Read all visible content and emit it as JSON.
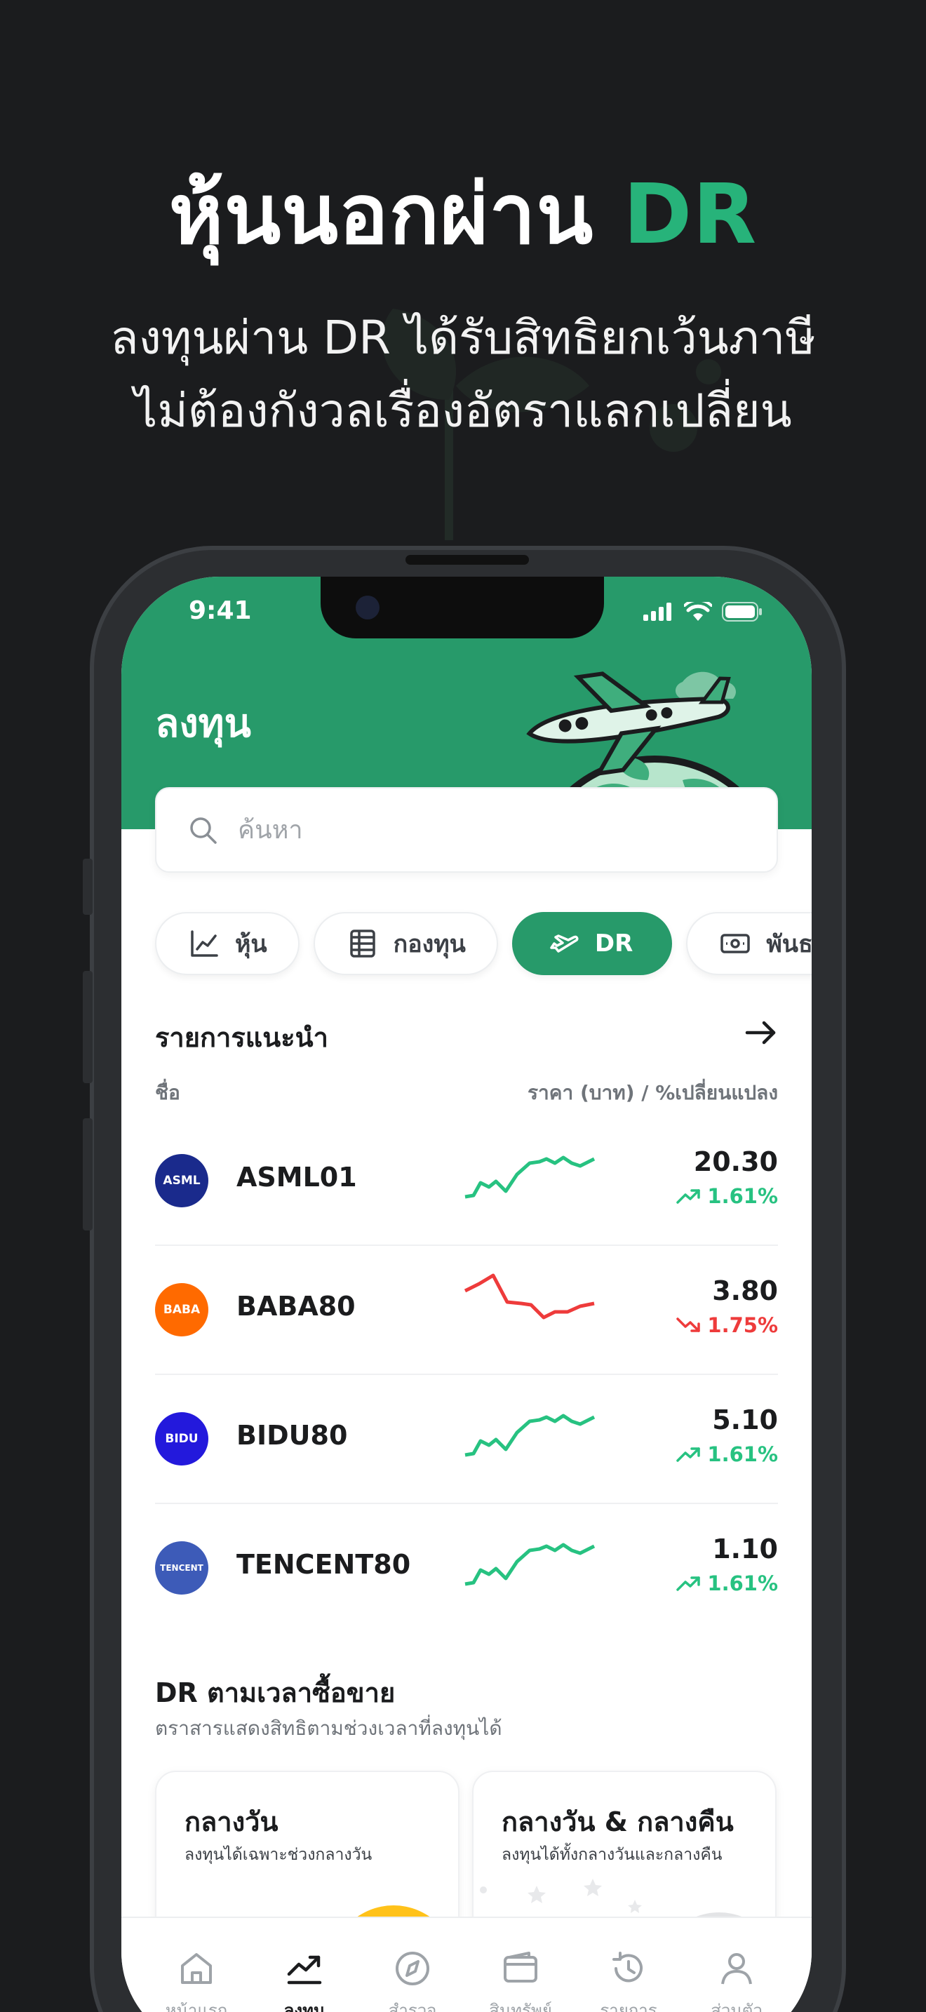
{
  "hero": {
    "title_main": "หุ้นนอกผ่าน",
    "title_accent": "DR",
    "subtitle_line1": "ลงทุนผ่าน DR ได้รับสิทธิยกเว้นภาษี",
    "subtitle_line2": "ไม่ต้องกังวลเรื่องอัตราแลกเปลี่ยน"
  },
  "status_bar": {
    "time": "9:41"
  },
  "header": {
    "title": "ลงทุน"
  },
  "search": {
    "placeholder": "ค้นหา",
    "value": ""
  },
  "chips": [
    {
      "label": "หุ้น",
      "icon": "chart-line-icon",
      "active": false
    },
    {
      "label": "กองทุน",
      "icon": "stack-icon",
      "active": false
    },
    {
      "label": "DR",
      "icon": "plane-icon",
      "active": true
    },
    {
      "label": "พันธ",
      "icon": "bond-ticket-icon",
      "active": false
    }
  ],
  "recommended": {
    "title": "รายการแนะนำ",
    "col_name": "ชื่อ",
    "col_price": "ราคา (บาท) / %เปลี่ยนแปลง",
    "items": [
      {
        "logo": "ASML",
        "symbol": "ASML01",
        "price": "20.30",
        "change": "1.61%",
        "direction": "up"
      },
      {
        "logo": "BABA",
        "symbol": "BABA80",
        "price": "3.80",
        "change": "1.75%",
        "direction": "down"
      },
      {
        "logo": "BIDU",
        "symbol": "BIDU80",
        "price": "5.10",
        "change": "1.61%",
        "direction": "up"
      },
      {
        "logo": "TENCENT",
        "symbol": "TENCENT80",
        "price": "1.10",
        "change": "1.61%",
        "direction": "up"
      }
    ]
  },
  "dr_by_time": {
    "title": "DR ตามเวลาซื้อขาย",
    "subtitle": "ตราสารแสดงสิทธิตามช่วงเวลาที่ลงทุนได้",
    "cards": [
      {
        "title": "กลางวัน",
        "subtitle": "ลงทุนได้เฉพาะช่วงกลางวัน"
      },
      {
        "title": "กลางวัน & กลางคืน",
        "subtitle": "ลงทุนได้ทั้งกลางวันและกลางคืน"
      }
    ]
  },
  "tabbar": [
    {
      "label": "หน้าแรก",
      "icon": "home-icon"
    },
    {
      "label": "ลงทุน",
      "icon": "trend-icon",
      "active": true
    },
    {
      "label": "สำรวจ",
      "icon": "compass-icon"
    },
    {
      "label": "สินทรัพย์",
      "icon": "wallet-icon"
    },
    {
      "label": "รายการ",
      "icon": "history-icon"
    },
    {
      "label": "ส่วนตัว",
      "icon": "user-icon"
    }
  ],
  "colors": {
    "brand_green": "#279a6a",
    "accent_green": "#27b37a",
    "up": "#27c281",
    "down": "#ee3b3b",
    "logo_asml": "#1a2a8c",
    "logo_baba": "#ff6a00",
    "logo_bidu": "#2319dc",
    "logo_tencent": "#3d5bb8"
  }
}
